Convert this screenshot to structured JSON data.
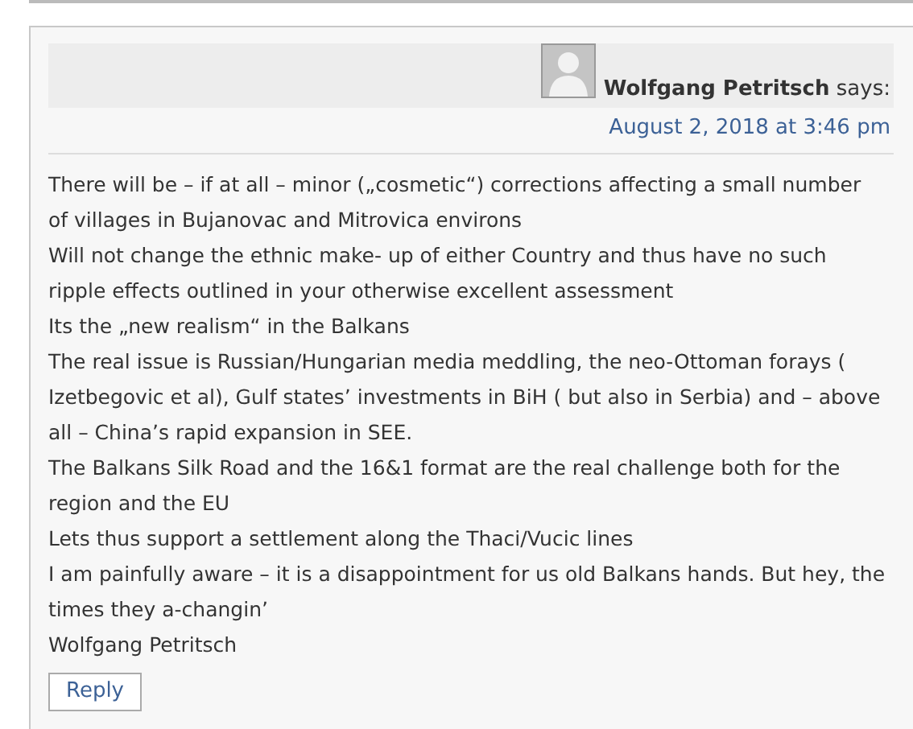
{
  "comment": {
    "author": "Wolfgang Petritsch",
    "says": "says:",
    "date": "August 2, 2018 at 3:46 pm",
    "paragraphs": [
      "There will be – if at all – minor („cosmetic“) corrections affecting a small number of villages in Bujanovac and Mitrovica environs",
      "Will not change the ethnic make- up of either Country and thus have no such ripple effects outlined in your otherwise excellent assessment",
      "Its the „new realism“ in the Balkans",
      "The real issue is Russian/Hungarian media meddling, the neo-Ottoman forays ( Izetbegovic et al), Gulf states’ investments in BiH ( but also in Serbia) and – above all – China’s rapid expansion in SEE.",
      "The Balkans Silk Road and the 16&1 format are the real challenge both for the region and the EU",
      "Lets thus support a settlement along the Thaci/Vucic lines",
      "I am painfully aware – it is a disappointment for us old Balkans hands. But hey, the times they a-changin’",
      "Wolfgang Petritsch"
    ],
    "reply": "Reply"
  }
}
